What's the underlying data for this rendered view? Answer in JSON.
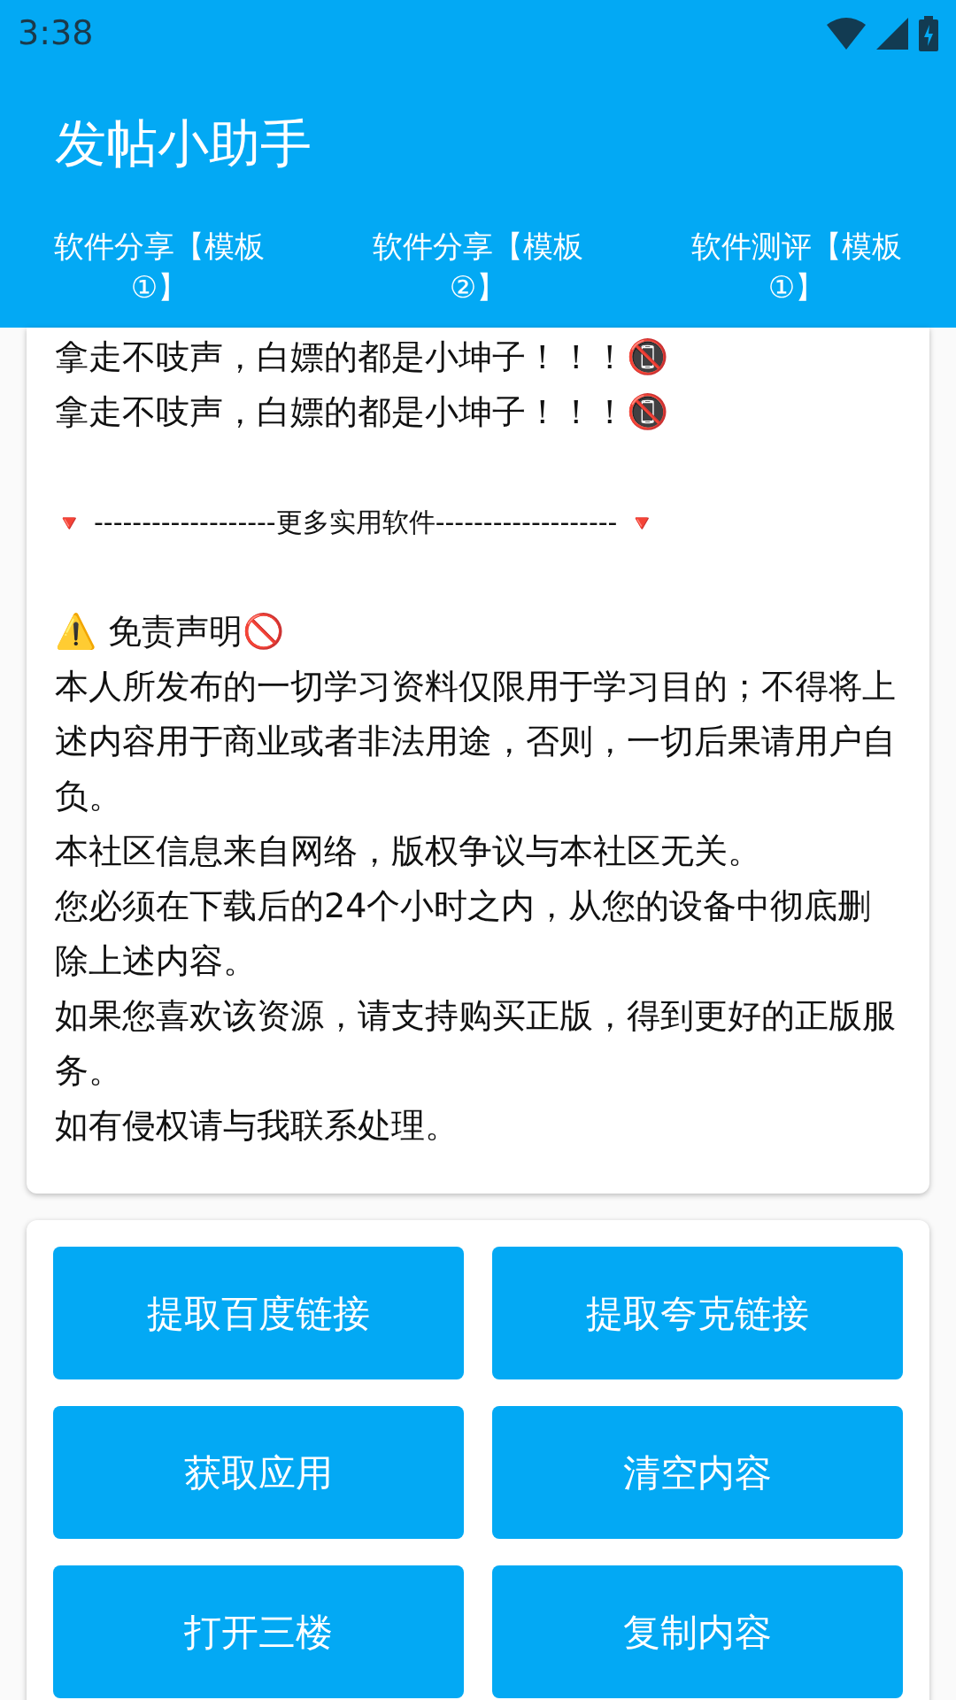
{
  "status_bar": {
    "time": "3:38"
  },
  "app_bar": {
    "title": "发帖小助手"
  },
  "tabs": [
    {
      "label": "软件分享【模板①】"
    },
    {
      "label": "软件分享【模板②】"
    },
    {
      "label": "软件测评【模板①】"
    }
  ],
  "content": {
    "lines": [
      {
        "kind": "text",
        "text": "拿走不吱声，白嫖的都是小坤子！！！📵"
      },
      {
        "kind": "text",
        "text": "拿走不吱声，白嫖的都是小坤子！！！📵"
      },
      {
        "kind": "blank"
      },
      {
        "kind": "divider",
        "marker": "🔻",
        "text": "-------------------更多实用软件-------------------",
        "marker_end": "🔻"
      },
      {
        "kind": "blank"
      },
      {
        "kind": "text",
        "text": "⚠️ 免责声明🚫"
      },
      {
        "kind": "text",
        "text": "本人所发布的一切学习资料仅限用于学习目的；不得将上述内容用于商业或者非法用途，否则，一切后果请用户自负。"
      },
      {
        "kind": "text",
        "text": "本社区信息来自网络，版权争议与本社区无关。"
      },
      {
        "kind": "text",
        "text": "您必须在下载后的24个小时之内，从您的设备中彻底删除上述内容。"
      },
      {
        "kind": "text",
        "text": "如果您喜欢该资源，请支持购买正版，得到更好的正版服务。"
      },
      {
        "kind": "text",
        "text": "如有侵权请与我联系处理。"
      }
    ]
  },
  "buttons": [
    "提取百度链接",
    "提取夸克链接",
    "获取应用",
    "清空内容",
    "打开三楼",
    "复制内容"
  ]
}
